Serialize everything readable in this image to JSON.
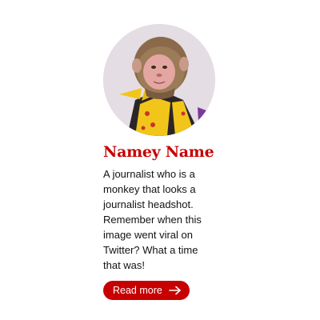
{
  "profile": {
    "name": "Namey Name",
    "bio": "A journalist who is a monkey that looks a journalist headshot. Remember when this image went viral on Twitter? What a time that was!",
    "read_more_label": "Read more",
    "read_more_icon": "arrow-right-icon",
    "avatar_icon": "monkey-portrait"
  },
  "colors": {
    "accent": "#c70000",
    "text": "#121212",
    "avatar_background": "#e6e0e6"
  }
}
